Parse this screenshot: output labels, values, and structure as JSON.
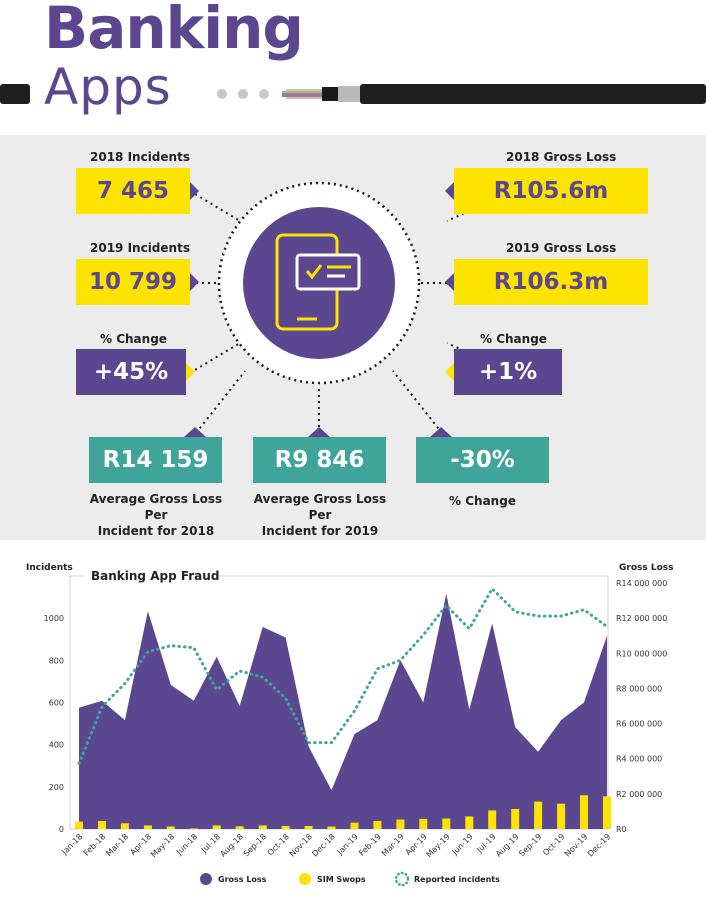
{
  "title": {
    "line1": "Banking",
    "line2": "Apps"
  },
  "stats": {
    "incidents_2018": {
      "label": "2018 Incidents",
      "value": "7 465"
    },
    "incidents_2019": {
      "label": "2019 Incidents",
      "value": "10 799"
    },
    "incidents_change": {
      "label": "% Change",
      "value": "+45%"
    },
    "loss_2018": {
      "label": "2018 Gross Loss",
      "value": "R105.6m"
    },
    "loss_2019": {
      "label": "2019 Gross Loss",
      "value": "R106.3m"
    },
    "loss_change": {
      "label": "% Change",
      "value": "+1%"
    },
    "avg_2018": {
      "value": "R14 159",
      "caption1": "Average Gross Loss Per",
      "caption2": "Incident for 2018"
    },
    "avg_2019": {
      "value": "R9 846",
      "caption1": "Average Gross Loss Per",
      "caption2": "Incident for 2019"
    },
    "avg_change": {
      "value": "-30%",
      "caption": "% Change"
    }
  },
  "colors": {
    "purple": "#5b4690",
    "yellow": "#fde300",
    "teal": "#3fa59b",
    "panel": "#ececec"
  },
  "icon": "mobile-checklist-icon",
  "chart_data": {
    "type": "area",
    "title": "Banking App Fraud",
    "ylabel_left": "Incidents",
    "ylabel_right": "Gross Loss",
    "left_ticks": [
      "0",
      "200",
      "400",
      "600",
      "800",
      "1000"
    ],
    "right_ticks": [
      "R0",
      "R2 000 000",
      "R4 000 000",
      "R6 000 000",
      "R8 000 000",
      "R10 000 000",
      "R12 000 000",
      "R14 000 000"
    ],
    "ylim_left": [
      0,
      1200
    ],
    "ylim_right": [
      0,
      14400000
    ],
    "categories": [
      "Jan-18",
      "Feb-18",
      "Mar-18",
      "Apr-18",
      "May-18",
      "Jun-18",
      "Jul-18",
      "Aug-18",
      "Sep-18",
      "Oct-18",
      "Nov-18",
      "Dec-18",
      "Jan-19",
      "Feb-19",
      "Mar-19",
      "Apr-19",
      "May-19",
      "Jun-19",
      "Jul-19",
      "Aug-19",
      "Sep-19",
      "Oct-19",
      "Nov-19",
      "Dec-19"
    ],
    "series": [
      {
        "name": "Gross Loss",
        "type": "area",
        "axis": "right",
        "values": [
          6900000,
          7300000,
          6200000,
          12400000,
          8200000,
          7300000,
          9800000,
          7000000,
          11500000,
          10900000,
          4700000,
          2200000,
          5400000,
          6200000,
          9600000,
          7200000,
          13400000,
          6800000,
          11700000,
          5800000,
          4400000,
          6200000,
          7200000,
          11000000
        ]
      },
      {
        "name": "SIM Swops",
        "type": "bar",
        "axis": "left",
        "values": [
          35,
          38,
          27,
          17,
          12,
          3,
          17,
          13,
          17,
          14,
          14,
          12,
          30,
          38,
          45,
          48,
          50,
          60,
          88,
          95,
          130,
          120,
          160,
          155
        ]
      },
      {
        "name": "Reported incidents",
        "type": "line",
        "axis": "left",
        "values": [
          310,
          580,
          690,
          840,
          870,
          860,
          660,
          750,
          720,
          620,
          410,
          410,
          560,
          760,
          800,
          920,
          1060,
          950,
          1140,
          1030,
          1010,
          1010,
          1040,
          960
        ]
      }
    ],
    "legend_position": "bottom"
  }
}
